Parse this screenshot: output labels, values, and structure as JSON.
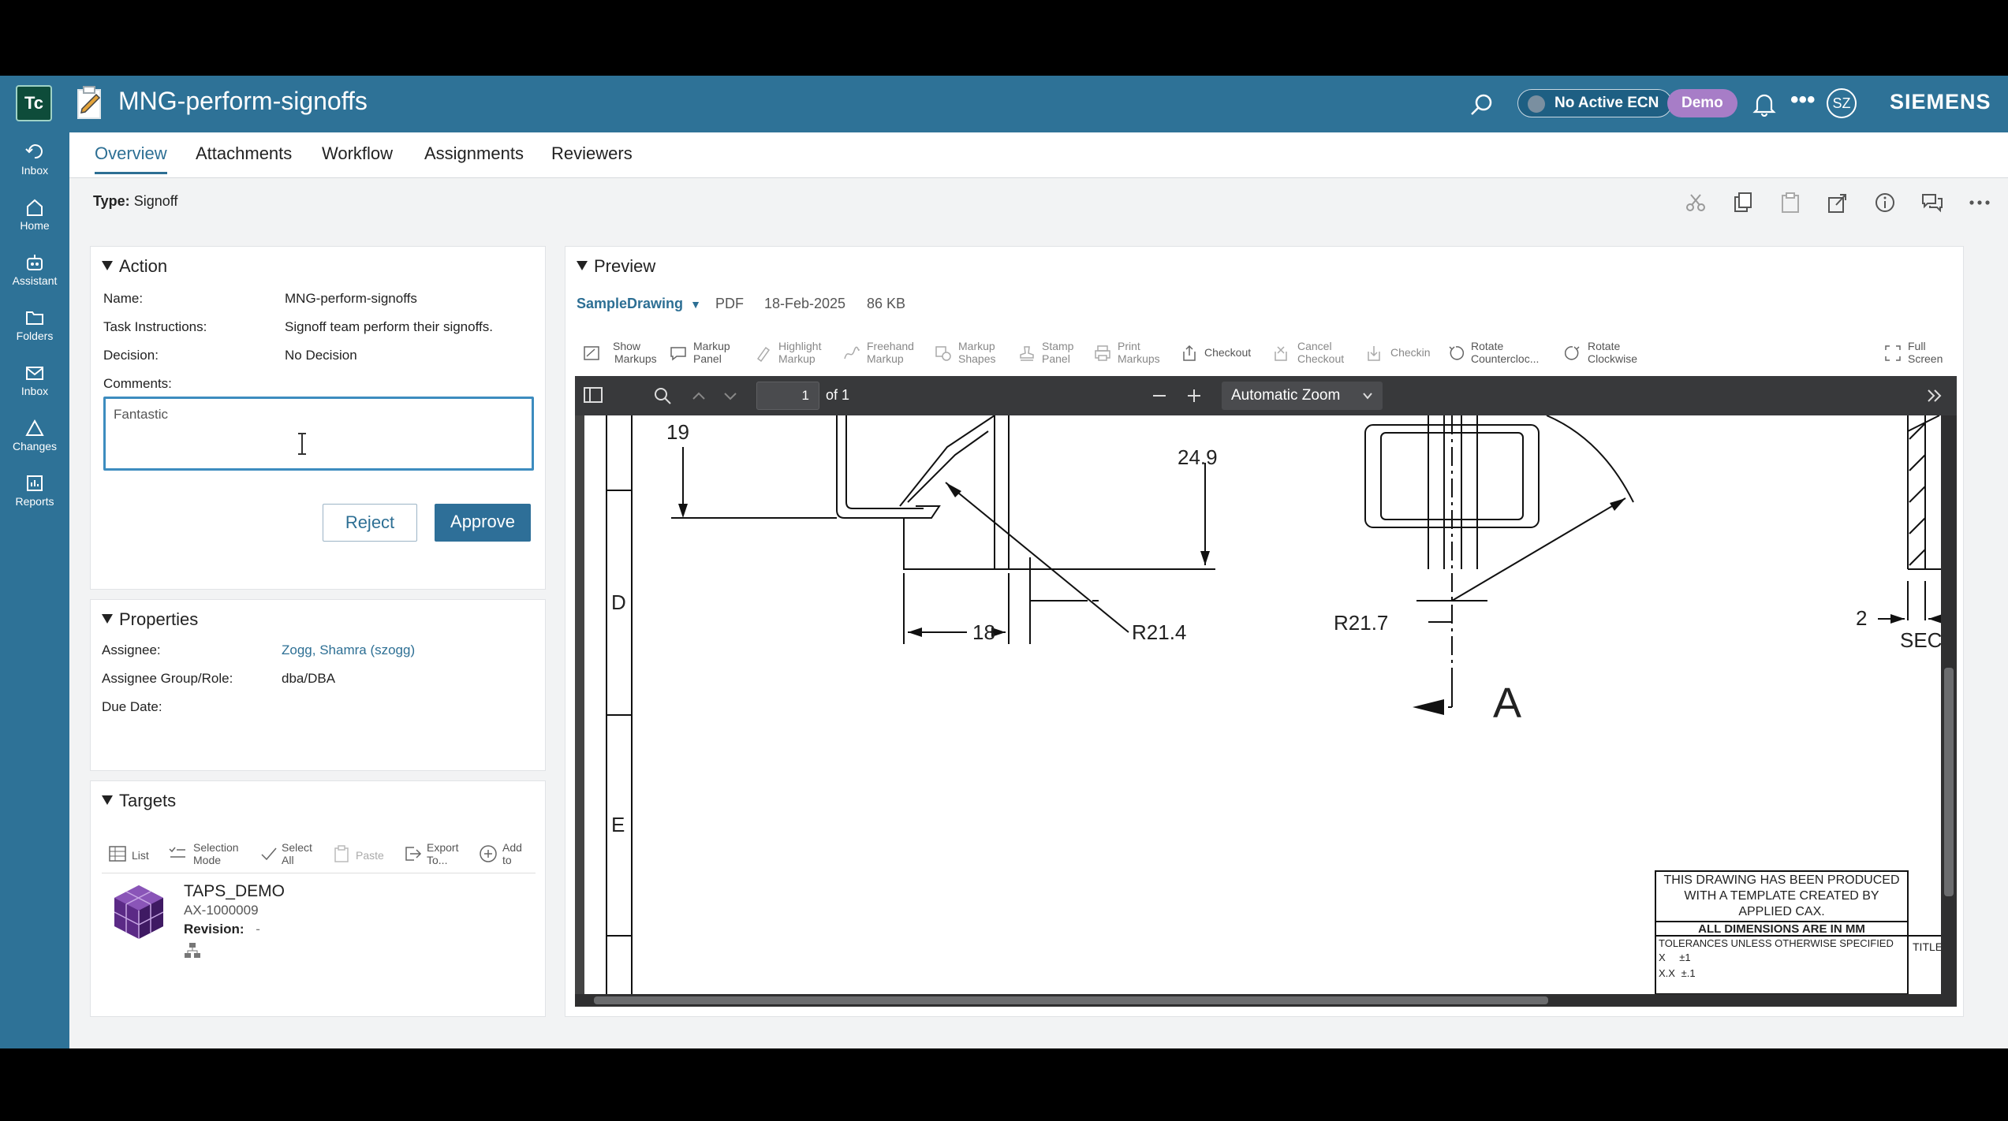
{
  "header": {
    "logo_text": "Tc",
    "title": "MNG-perform-signoffs",
    "ecn_label": "No Active ECN",
    "demo_badge": "Demo",
    "avatar_initials": "SZ",
    "brand": "SIEMENS",
    "colors": {
      "header_bg": "#2e7297",
      "demo_badge": "#a77dc7",
      "accent": "#2d6f94"
    }
  },
  "nav": {
    "items": [
      {
        "label": "Inbox",
        "icon": "back-arrow-icon"
      },
      {
        "label": "Home",
        "icon": "home-icon"
      },
      {
        "label": "Assistant",
        "icon": "assistant-icon"
      },
      {
        "label": "Folders",
        "icon": "folder-icon"
      },
      {
        "label": "Inbox",
        "icon": "inbox-icon"
      },
      {
        "label": "Changes",
        "icon": "changes-icon"
      },
      {
        "label": "Reports",
        "icon": "reports-icon"
      }
    ]
  },
  "tabs": [
    {
      "label": "Overview",
      "active": true
    },
    {
      "label": "Attachments"
    },
    {
      "label": "Workflow"
    },
    {
      "label": "Assignments"
    },
    {
      "label": "Reviewers"
    }
  ],
  "typebar": {
    "label": "Type:",
    "value": "Signoff"
  },
  "action": {
    "title": "Action",
    "name_label": "Name:",
    "name_value": "MNG-perform-signoffs",
    "instr_label": "Task Instructions:",
    "instr_value": "Signoff team perform their signoffs.",
    "decision_label": "Decision:",
    "decision_value": "No Decision",
    "comments_label": "Comments:",
    "comments_value": "Fantastic",
    "reject": "Reject",
    "approve": "Approve"
  },
  "properties": {
    "title": "Properties",
    "assignee_label": "Assignee:",
    "assignee_value": "Zogg, Shamra (szogg)",
    "group_label": "Assignee Group/Role:",
    "group_value": "dba/DBA",
    "due_label": "Due Date:"
  },
  "targets": {
    "title": "Targets",
    "tools": [
      {
        "l1": "List",
        "l2": ""
      },
      {
        "l1": "Selection",
        "l2": "Mode"
      },
      {
        "l1": "Select",
        "l2": "All"
      },
      {
        "l1": "Paste",
        "l2": ""
      },
      {
        "l1": "Export",
        "l2": "To..."
      },
      {
        "l1": "Add",
        "l2": "to"
      }
    ],
    "item_name": "TAPS_DEMO",
    "item_id": "AX-1000009",
    "revision_label": "Revision:",
    "revision_value": "-"
  },
  "preview": {
    "title": "Preview",
    "dataset": "SampleDrawing",
    "format": "PDF",
    "date": "18-Feb-2025",
    "size": "86 KB",
    "tools": [
      {
        "l1": "Show",
        "l2": "Markups"
      },
      {
        "l1": "Markup",
        "l2": "Panel"
      },
      {
        "l1": "Highlight",
        "l2": "Markup"
      },
      {
        "l1": "Freehand",
        "l2": "Markup"
      },
      {
        "l1": "Markup",
        "l2": "Shapes"
      },
      {
        "l1": "Stamp",
        "l2": "Panel"
      },
      {
        "l1": "Print",
        "l2": "Markups"
      },
      {
        "l1": "Checkout",
        "l2": ""
      },
      {
        "l1": "Cancel",
        "l2": "Checkout"
      },
      {
        "l1": "Checkin",
        "l2": ""
      },
      {
        "l1": "Rotate",
        "l2": "Countercloc..."
      },
      {
        "l1": "Rotate",
        "l2": "Clockwise"
      },
      {
        "l1": "Full",
        "l2": "Screen"
      }
    ],
    "viewer": {
      "page": "1",
      "of": "of 1",
      "zoom": "Automatic Zoom"
    }
  },
  "drawing": {
    "dims": [
      "19",
      "24.9",
      "18",
      "R21.4",
      "R21.7",
      "2",
      "SEC",
      "A",
      "D",
      "E"
    ],
    "tb_line1": "THIS DRAWING HAS BEEN PRODUCED",
    "tb_line2": "WITH A TEMPLATE  CREATED BY",
    "tb_line3": "APPLIED CAX.",
    "tb_dims": "ALL DIMENSIONS ARE IN MM",
    "tb_tol": "TOLERANCES UNLESS OTHERWISE SPECIFIED",
    "tb_x": "X",
    "tb_x_v": "±1",
    "tb_xx": "X.X",
    "tb_xx_v": "±.1",
    "tb_title": "TITLE"
  }
}
